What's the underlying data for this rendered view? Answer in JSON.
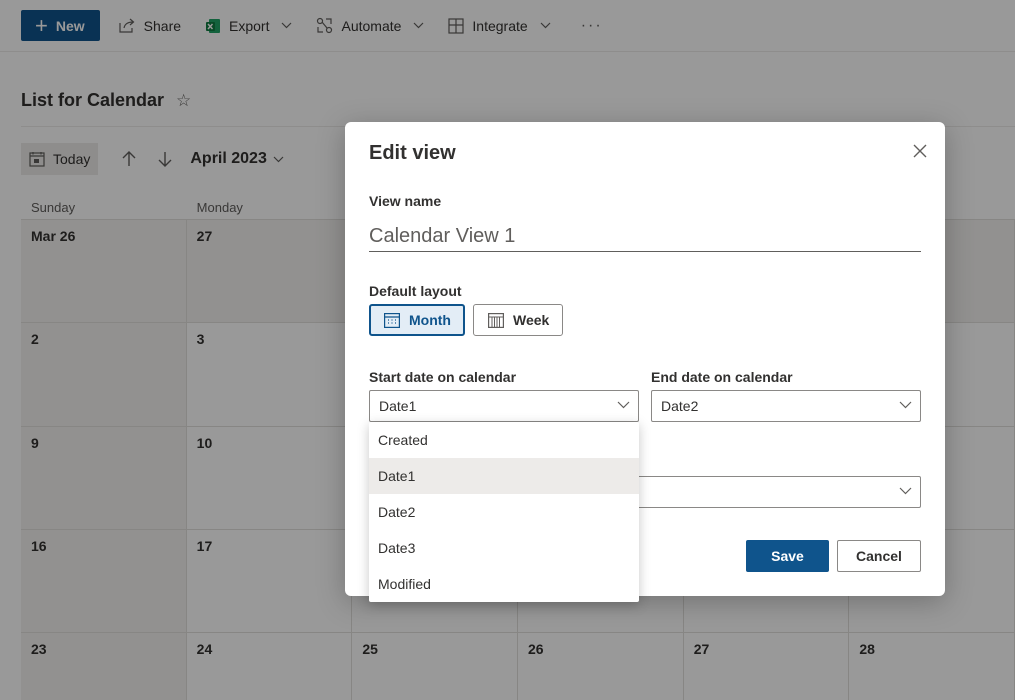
{
  "commandbar": {
    "new_label": "New",
    "share_label": "Share",
    "export_label": "Export",
    "automate_label": "Automate",
    "integrate_label": "Integrate",
    "more_label": "···"
  },
  "list": {
    "title": "List for Calendar",
    "favorite_icon": "☆"
  },
  "calendar_nav": {
    "today_label": "Today",
    "month_label": "April 2023"
  },
  "calendar": {
    "weekdays": [
      "Sunday",
      "Monday",
      "",
      "",
      "",
      ""
    ],
    "weeks": [
      [
        "Mar 26",
        "27",
        "",
        "",
        "",
        ""
      ],
      [
        "2",
        "3",
        "",
        "",
        "",
        ""
      ],
      [
        "9",
        "10",
        "",
        "",
        "",
        ""
      ],
      [
        "16",
        "17",
        "",
        "",
        "",
        ""
      ],
      [
        "23",
        "24",
        "25",
        "26",
        "27",
        "28"
      ]
    ]
  },
  "dialog": {
    "title": "Edit view",
    "view_name_label": "View name",
    "view_name_value": "Calendar View 1",
    "default_layout_label": "Default layout",
    "layout_month": "Month",
    "layout_week": "Week",
    "start_date_label": "Start date on calendar",
    "start_date_value": "Date1",
    "end_date_label": "End date on calendar",
    "end_date_value": "Date2",
    "save_label": "Save",
    "cancel_label": "Cancel"
  },
  "start_date_options": [
    {
      "label": "Created",
      "selected": false
    },
    {
      "label": "Date1",
      "selected": true
    },
    {
      "label": "Date2",
      "selected": false
    },
    {
      "label": "Date3",
      "selected": false
    },
    {
      "label": "Modified",
      "selected": false
    }
  ],
  "colors": {
    "accent": "#0f548c",
    "selected_option_bg": "#edebe9"
  },
  "icons": {
    "new": "plus-icon",
    "share": "share-icon",
    "export": "excel-icon",
    "automate": "automate-icon",
    "integrate": "integrate-icon",
    "close": "close-icon",
    "month": "calendar-month-icon",
    "week": "calendar-week-icon"
  }
}
